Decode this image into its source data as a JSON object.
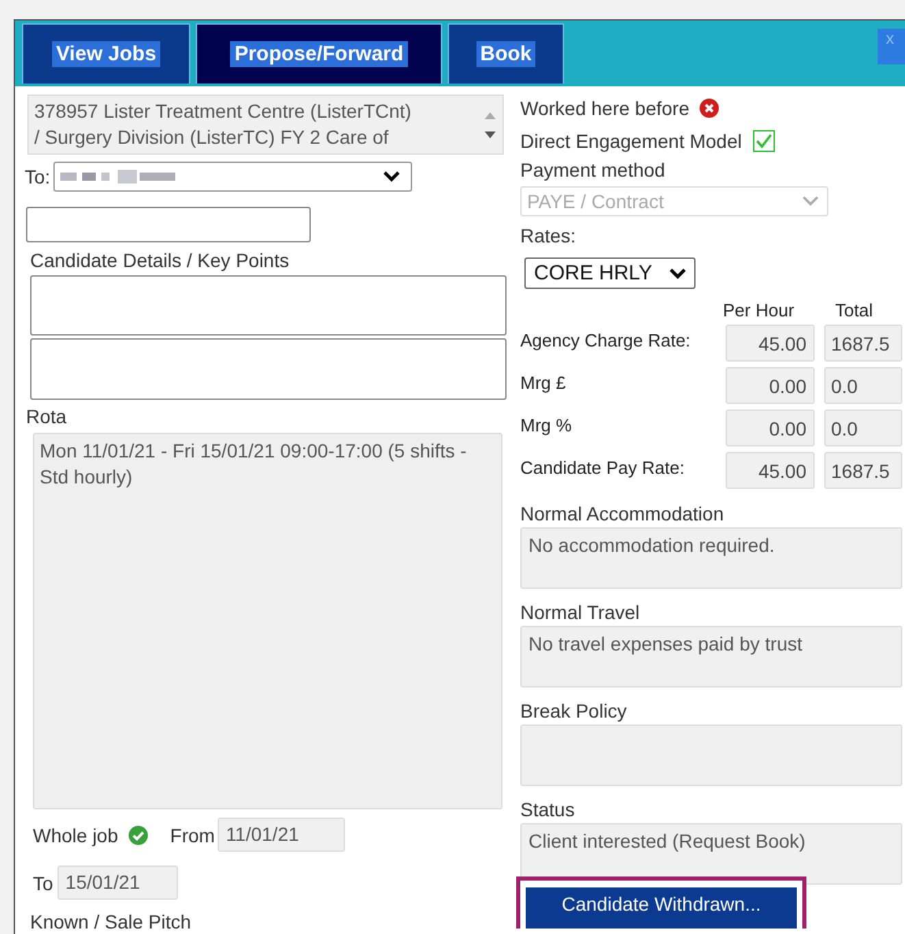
{
  "tabs": [
    {
      "label": "View Jobs",
      "selected": false
    },
    {
      "label": "Propose/Forward",
      "selected": true
    },
    {
      "label": "Book",
      "selected": false
    }
  ],
  "close_label": "x",
  "job": {
    "lines": [
      "378957 Lister Treatment Centre (ListerTCnt)",
      "/ Surgery Division (ListerTC)  FY 2 Care of"
    ]
  },
  "to_label": "To:",
  "candidate_details": {
    "label": "Candidate Details / Key Points"
  },
  "rota": {
    "label": "Rota",
    "value": "Mon 11/01/21 - Fri 15/01/21 09:00-17:00 (5 shifts - Std hourly)"
  },
  "whole_job": {
    "label": "Whole job",
    "checked": true
  },
  "from": {
    "label": "From",
    "value": "11/01/21"
  },
  "to": {
    "label": "To",
    "value": "15/01/21"
  },
  "known_label": "Known / Sale Pitch",
  "worked_before": {
    "label": "Worked here before",
    "checked": false
  },
  "direct_engagement": {
    "label": "Direct Engagement Model",
    "checked": true
  },
  "payment": {
    "label": "Payment method",
    "value": "PAYE / Contract",
    "disabled": true
  },
  "rates": {
    "label": "Rates:",
    "value": "CORE HRLY",
    "columns": [
      "Per Hour",
      "Total"
    ],
    "rows": [
      {
        "label": "Agency Charge Rate:",
        "per_hour": "45.00",
        "total": "1687.5"
      },
      {
        "label": "Mrg £",
        "per_hour": "0.00",
        "total": "0.0"
      },
      {
        "label": "Mrg %",
        "per_hour": "0.00",
        "total": "0.0"
      },
      {
        "label": "Candidate Pay Rate:",
        "per_hour": "45.00",
        "total": "1687.5"
      }
    ]
  },
  "info": [
    {
      "label": "Normal Accommodation",
      "value": "No accommodation required."
    },
    {
      "label": "Normal Travel",
      "value": "No travel expenses paid by trust"
    },
    {
      "label": "Break Policy"
    },
    {
      "label": "Status",
      "value": "Client interested  (Request Book)"
    }
  ],
  "action_button": {
    "label": "Candidate Withdrawn...",
    "highlighted": true
  }
}
